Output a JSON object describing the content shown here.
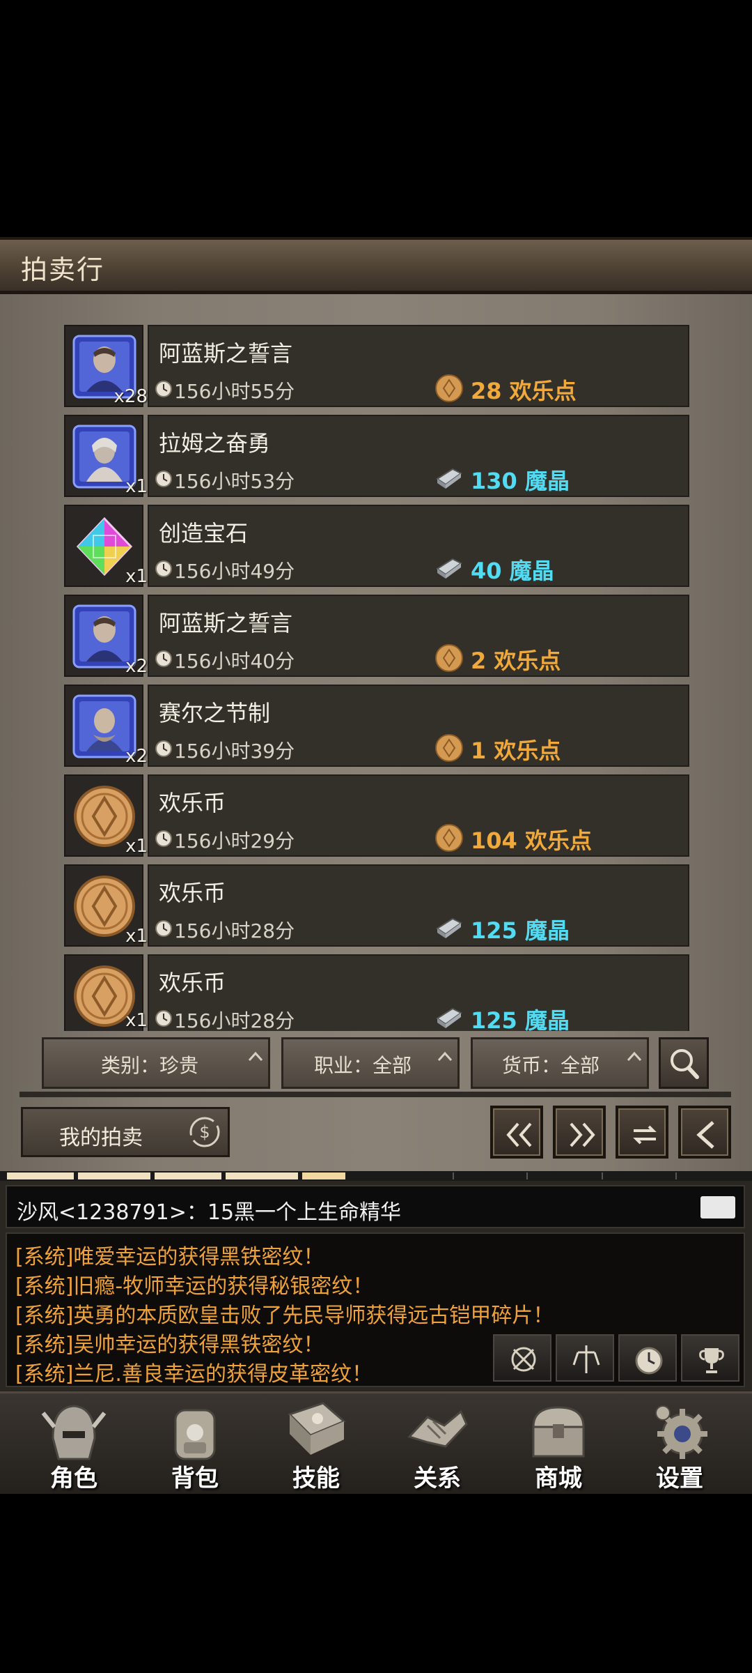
{
  "header": {
    "title": "拍卖行"
  },
  "listings": [
    {
      "name": "阿蓝斯之誓言",
      "count": "x28",
      "time": "156小时55分",
      "price": "28 欢乐点",
      "currency": "joy",
      "icon": "portrait-card-icon"
    },
    {
      "name": "拉姆之奋勇",
      "count": "x1",
      "time": "156小时53分",
      "price": "130 魔晶",
      "currency": "crystal",
      "icon": "portrait-card-icon"
    },
    {
      "name": "创造宝石",
      "count": "x1",
      "time": "156小时49分",
      "price": "40 魔晶",
      "currency": "crystal",
      "icon": "gem-icon"
    },
    {
      "name": "阿蓝斯之誓言",
      "count": "x2",
      "time": "156小时40分",
      "price": "2 欢乐点",
      "currency": "joy",
      "icon": "portrait-card-icon"
    },
    {
      "name": "赛尔之节制",
      "count": "x2",
      "time": "156小时39分",
      "price": "1 欢乐点",
      "currency": "joy",
      "icon": "portrait-card-icon"
    },
    {
      "name": "欢乐币",
      "count": "x1",
      "time": "156小时29分",
      "price": "104 欢乐点",
      "currency": "joy",
      "icon": "coin-icon"
    },
    {
      "name": "欢乐币",
      "count": "x1",
      "time": "156小时28分",
      "price": "125 魔晶",
      "currency": "crystal",
      "icon": "coin-icon"
    },
    {
      "name": "欢乐币",
      "count": "x1",
      "time": "156小时28分",
      "price": "125 魔晶",
      "currency": "crystal",
      "icon": "coin-icon"
    }
  ],
  "filters": {
    "category": "类别：珍贵",
    "profession": "职业：全部",
    "currency": "货币：全部"
  },
  "my_auction_label": "我的拍卖",
  "chat": {
    "input_line": "沙风<1238791>：15黑一个上生命精华",
    "messages": [
      "[系统]唯爱幸运的获得黑铁密纹！",
      "[系统]旧瘾-牧师幸运的获得秘银密纹！",
      "[系统]英勇的本质欧皇击败了先民导师获得远古铠甲碎片！",
      "[系统]吴帅幸运的获得黑铁密纹！",
      "[系统]兰尼.善良幸运的获得皮革密纹！"
    ]
  },
  "bottom_nav": [
    {
      "label": "角色",
      "icon": "helmet-icon"
    },
    {
      "label": "背包",
      "icon": "backpack-icon"
    },
    {
      "label": "技能",
      "icon": "spellbook-icon"
    },
    {
      "label": "关系",
      "icon": "handshake-icon"
    },
    {
      "label": "商城",
      "icon": "chest-icon"
    },
    {
      "label": "设置",
      "icon": "gear-icon"
    }
  ],
  "colors": {
    "gold": "#f0a93a",
    "cyan": "#52dcf4",
    "system_msg": "#f0a23a"
  }
}
